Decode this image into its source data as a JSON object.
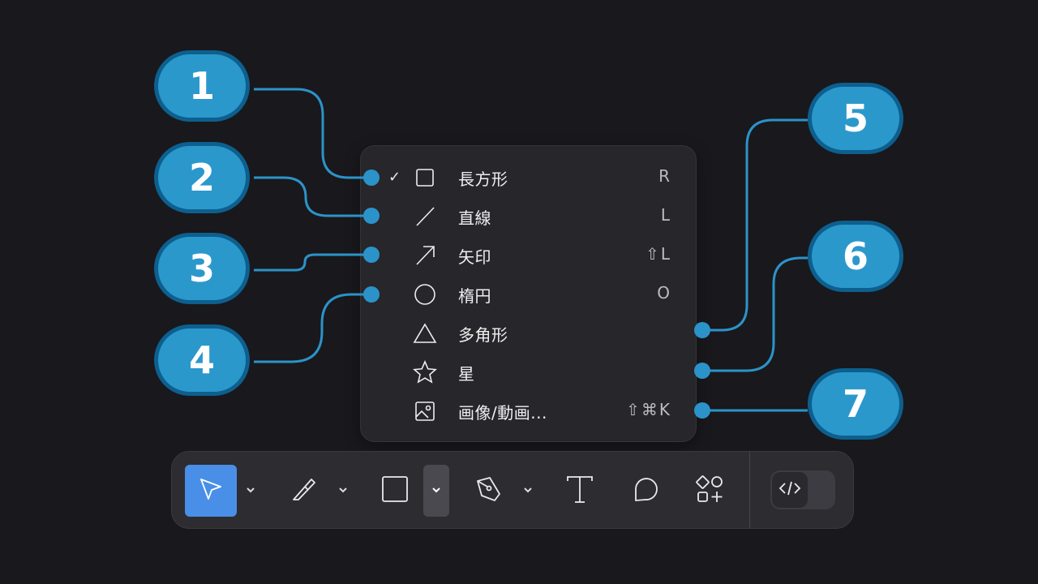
{
  "callouts": [
    "1",
    "2",
    "3",
    "4",
    "5",
    "6",
    "7"
  ],
  "menu": {
    "items": [
      {
        "icon": "square-icon",
        "label": "長方形",
        "shortcut": "R",
        "checked": true
      },
      {
        "icon": "line-icon",
        "label": "直線",
        "shortcut": "L",
        "checked": false
      },
      {
        "icon": "arrow-icon",
        "label": "矢印",
        "shortcut": "⇧L",
        "checked": false
      },
      {
        "icon": "ellipse-icon",
        "label": "楕円",
        "shortcut": "O",
        "checked": false
      },
      {
        "icon": "polygon-icon",
        "label": "多角形",
        "shortcut": "",
        "checked": false
      },
      {
        "icon": "star-icon",
        "label": "星",
        "shortcut": "",
        "checked": false
      },
      {
        "icon": "image-icon",
        "label": "画像/動画...",
        "shortcut": "⇧⌘K",
        "checked": false
      }
    ],
    "check_mark": "✓"
  },
  "toolbar": {
    "tools": [
      "select-tool",
      "scalpel-tool",
      "shape-tool",
      "pen-tool",
      "text-tool",
      "comment-tool",
      "resources-tool",
      "code-toggle"
    ],
    "active_tool": "select-tool",
    "active_dropdown": "shape-tool"
  },
  "colors": {
    "accent": "#2b98cc",
    "accent_border": "#0d5f8e",
    "tool_active": "#4a8fe7",
    "background": "#19181c",
    "menu_bg": "#27262b"
  }
}
